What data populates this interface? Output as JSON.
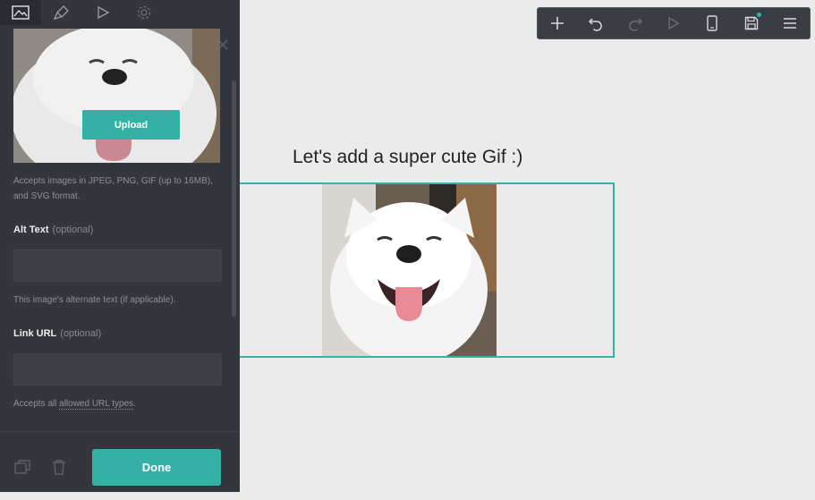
{
  "panel": {
    "tabs": [
      {
        "name": "image-icon",
        "active": true
      },
      {
        "name": "brush-icon",
        "active": false
      },
      {
        "name": "play-icon",
        "active": false
      },
      {
        "name": "gear-icon",
        "active": false
      }
    ],
    "upload_label": "Upload",
    "accepts_images_text": "Accepts images in JPEG, PNG, GIF (up to 16MB),",
    "accepts_images_text_2": "and SVG format.",
    "alt_text_label": "Alt Text",
    "alt_text_optional": "(optional)",
    "alt_text_value": "",
    "alt_text_help": "This image's alternate text (if applicable).",
    "link_url_label": "Link URL",
    "link_url_optional": "(optional)",
    "link_url_value": "",
    "link_help_prefix": "Accepts all ",
    "link_help_link": "allowed URL types",
    "link_help_suffix": ".",
    "done_label": "Done"
  },
  "toolbar": {
    "buttons": [
      "add-icon",
      "undo-icon",
      "redo-icon",
      "play-icon",
      "mobile-preview-icon",
      "save-icon",
      "menu-icon"
    ]
  },
  "canvas": {
    "heading": "Let's add a super cute Gif :)"
  },
  "colors": {
    "accent": "#33b1a4",
    "panel_bg": "#33363c",
    "canvas_bg": "#ebebeb",
    "toolbar_bg": "#3a3d43"
  }
}
